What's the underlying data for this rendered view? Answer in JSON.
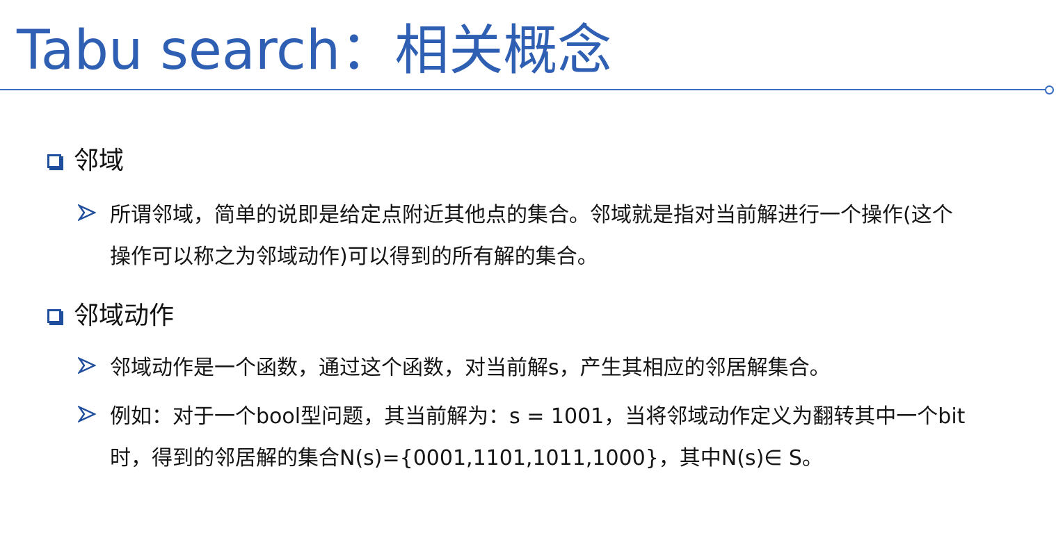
{
  "slide": {
    "title": "Tabu search：相关概念"
  },
  "sections": [
    {
      "heading": "邻域",
      "items": [
        "所谓邻域，简单的说即是给定点附近其他点的集合。邻域就是指对当前解进行一个操作(这个操作可以称之为邻域动作)可以得到的所有解的集合。"
      ]
    },
    {
      "heading": "邻域动作",
      "items": [
        "邻域动作是一个函数，通过这个函数，对当前解s，产生其相应的邻居解集合。",
        "例如：对于一个bool型问题，其当前解为：s = 1001，当将邻域动作定义为翻转其中一个bit时，得到的邻居解的集合N(s)={0001,1101,1011,1000}，其中N(s)∈ S。"
      ]
    }
  ],
  "colors": {
    "title": "#2f5fb3",
    "rule": "#3a6fc4",
    "bullet": "#1f4e9c"
  },
  "icons": {
    "section_bullet": "hollow-square-bullet-icon",
    "item_bullet": "arrowhead-bullet-icon"
  }
}
